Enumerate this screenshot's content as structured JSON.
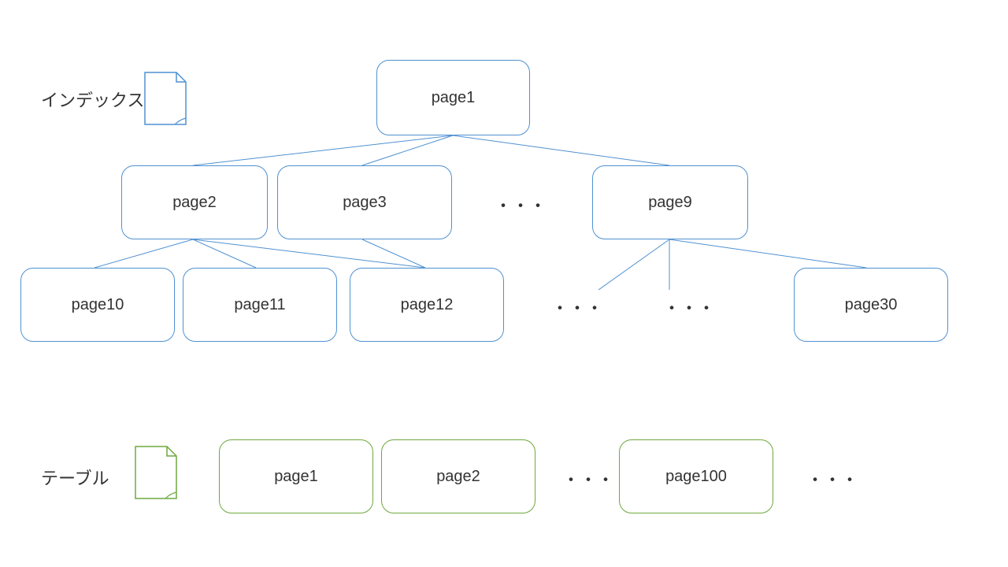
{
  "index": {
    "label": "インデックス",
    "root": {
      "label": "page1"
    },
    "level2": [
      {
        "label": "page2"
      },
      {
        "label": "page3"
      },
      {
        "ellipsis": "・・・"
      },
      {
        "label": "page9"
      }
    ],
    "level3": [
      {
        "label": "page10"
      },
      {
        "label": "page11"
      },
      {
        "label": "page12"
      },
      {
        "ellipsis1": "・・・"
      },
      {
        "ellipsis2": "・・・"
      },
      {
        "label": "page30"
      }
    ]
  },
  "table": {
    "label": "テーブル",
    "pages": [
      {
        "label": "page1"
      },
      {
        "label": "page2"
      },
      {
        "ellipsis1": "・・・"
      },
      {
        "label": "page100"
      },
      {
        "ellipsis2": "・・・"
      }
    ]
  },
  "colors": {
    "index_border": "#4f91d1",
    "table_border": "#6fa83e"
  }
}
